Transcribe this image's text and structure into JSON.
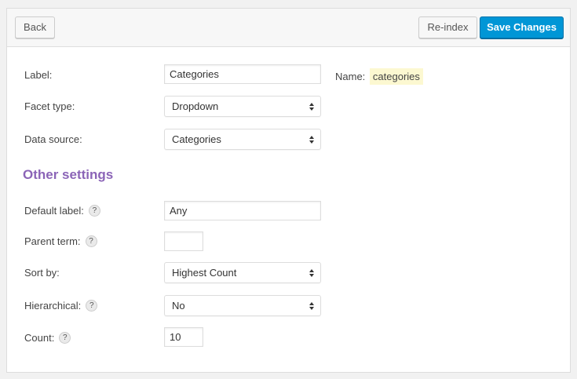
{
  "toolbar": {
    "back_label": "Back",
    "reindex_label": "Re-index",
    "save_label": "Save Changes"
  },
  "fields": {
    "label": {
      "label": "Label:",
      "value": "Categories"
    },
    "name": {
      "label": "Name:",
      "value": "categories"
    },
    "facet_type": {
      "label": "Facet type:",
      "value": "Dropdown"
    },
    "data_source": {
      "label": "Data source:",
      "value": "Categories"
    }
  },
  "other_settings": {
    "title": "Other settings",
    "default_label": {
      "label": "Default label:",
      "value": "Any"
    },
    "parent_term": {
      "label": "Parent term:",
      "value": ""
    },
    "sort_by": {
      "label": "Sort by:",
      "value": "Highest Count"
    },
    "hierarchical": {
      "label": "Hierarchical:",
      "value": "No"
    },
    "count": {
      "label": "Count:",
      "value": "10"
    }
  },
  "help_glyph": "?",
  "colors": {
    "primary_button": "#0096d6",
    "section_title": "#8b64b7",
    "name_highlight": "#fcf8d1"
  }
}
